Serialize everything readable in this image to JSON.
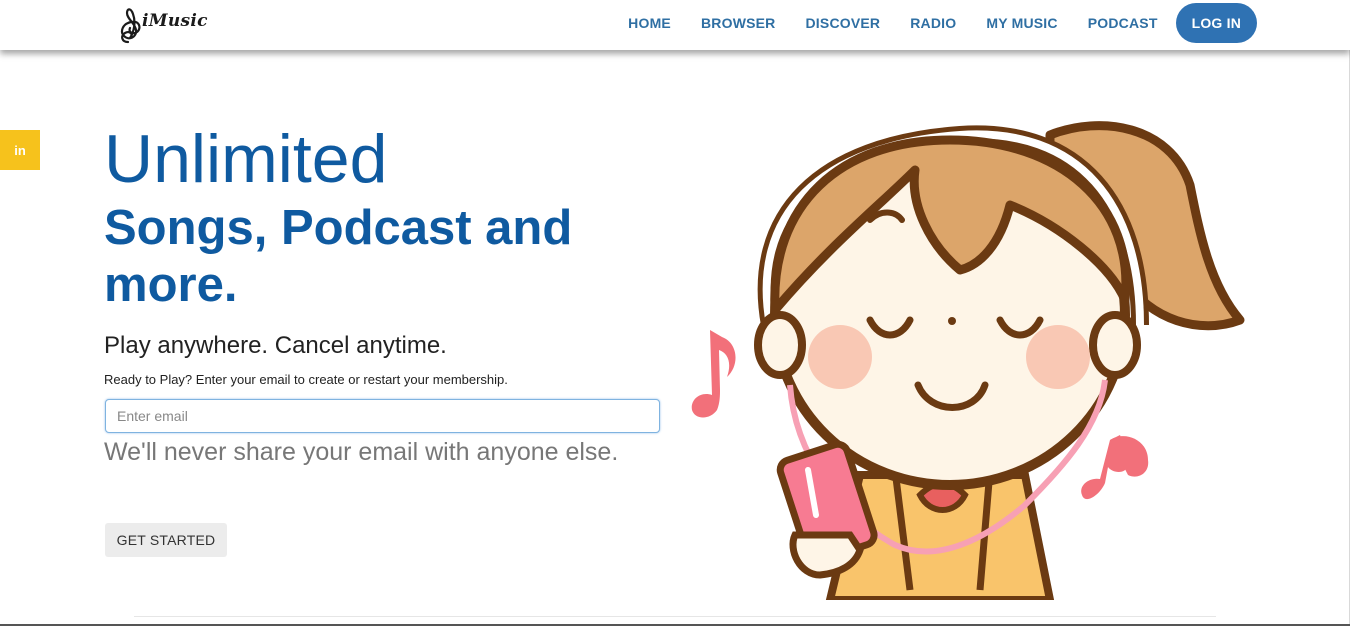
{
  "brand": {
    "logo_text": "iMusic"
  },
  "nav": {
    "items": [
      "HOME",
      "BROWSER",
      "DISCOVER",
      "RADIO",
      "MY MUSIC",
      "PODCAST"
    ],
    "login_label": "LOG IN"
  },
  "social": {
    "linkedin_label": "in"
  },
  "hero": {
    "title": "Unlimited",
    "subtitle": "Songs, Podcast and more.",
    "tagline": "Play anywhere. Cancel anytime.",
    "helper": "Ready to Play? Enter your email to create or restart your membership.",
    "email_placeholder": "Enter email",
    "email_value": "",
    "privacy_note": "We'll never share your email with anyone else.",
    "cta_label": "GET STARTED"
  },
  "colors": {
    "brand_blue": "#0f5aa0",
    "nav_link": "#2f6fa3",
    "login_bg": "#2f72b3",
    "social_tab": "#f6c21c"
  },
  "icons": {
    "logo": "treble-clef-icon",
    "linkedin": "linkedin-icon",
    "illustration": "girl-listening-music-illustration",
    "notes": "music-note-icon"
  }
}
